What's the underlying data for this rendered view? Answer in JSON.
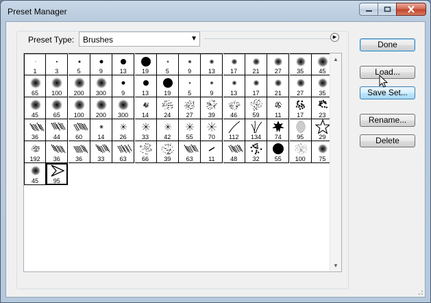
{
  "window": {
    "title": "Preset Manager"
  },
  "preset_type": {
    "label": "Preset Type:",
    "value": "Brushes"
  },
  "buttons": {
    "done": "Done",
    "load": "Load...",
    "save_set": "Save Set...",
    "rename": "Rename...",
    "delete": "Delete"
  },
  "brushes": [
    {
      "n": "1",
      "k": "hard",
      "r": 0.5
    },
    {
      "n": "3",
      "k": "hard",
      "r": 1
    },
    {
      "n": "5",
      "k": "hard",
      "r": 1.5
    },
    {
      "n": "9",
      "k": "hard",
      "r": 2.5
    },
    {
      "n": "13",
      "k": "hard",
      "r": 4
    },
    {
      "n": "19",
      "k": "hard",
      "r": 7
    },
    {
      "n": "5",
      "k": "soft",
      "r": 2
    },
    {
      "n": "9",
      "k": "soft",
      "r": 3
    },
    {
      "n": "13",
      "k": "soft",
      "r": 4
    },
    {
      "n": "17",
      "k": "soft",
      "r": 5
    },
    {
      "n": "21",
      "k": "soft",
      "r": 6
    },
    {
      "n": "27",
      "k": "soft",
      "r": 7
    },
    {
      "n": "35",
      "k": "soft",
      "r": 8
    },
    {
      "n": "45",
      "k": "soft",
      "r": 9
    },
    {
      "n": "65",
      "k": "soft",
      "r": 9
    },
    {
      "n": "100",
      "k": "soft",
      "r": 9
    },
    {
      "n": "200",
      "k": "soft",
      "r": 9
    },
    {
      "n": "300",
      "k": "soft",
      "r": 9
    },
    {
      "n": "9",
      "k": "hard",
      "r": 2.5
    },
    {
      "n": "13",
      "k": "hard",
      "r": 4
    },
    {
      "n": "19",
      "k": "hard",
      "r": 7
    },
    {
      "n": "5",
      "k": "soft",
      "r": 2
    },
    {
      "n": "9",
      "k": "soft",
      "r": 3
    },
    {
      "n": "13",
      "k": "soft",
      "r": 4
    },
    {
      "n": "17",
      "k": "soft",
      "r": 5
    },
    {
      "n": "21",
      "k": "soft",
      "r": 6
    },
    {
      "n": "27",
      "k": "soft",
      "r": 7
    },
    {
      "n": "35",
      "k": "soft",
      "r": 8
    },
    {
      "n": "45",
      "k": "soft",
      "r": 9
    },
    {
      "n": "65",
      "k": "soft",
      "r": 9
    },
    {
      "n": "100",
      "k": "soft",
      "r": 9
    },
    {
      "n": "200",
      "k": "soft",
      "r": 9
    },
    {
      "n": "300",
      "k": "soft",
      "r": 9
    },
    {
      "n": "14",
      "k": "spray",
      "r": 4
    },
    {
      "n": "24",
      "k": "spray",
      "r": 8
    },
    {
      "n": "27",
      "k": "spray",
      "r": 8
    },
    {
      "n": "39",
      "k": "spray",
      "r": 8
    },
    {
      "n": "46",
      "k": "spray",
      "r": 8
    },
    {
      "n": "59",
      "k": "spray",
      "r": 9
    },
    {
      "n": "11",
      "k": "spray",
      "r": 5
    },
    {
      "n": "17",
      "k": "scatter",
      "r": 7
    },
    {
      "n": "23",
      "k": "scatter",
      "r": 8
    },
    {
      "n": "36",
      "k": "chalk",
      "r": 9
    },
    {
      "n": "44",
      "k": "chalk",
      "r": 9
    },
    {
      "n": "60",
      "k": "chalk",
      "r": 9
    },
    {
      "n": "14",
      "k": "star",
      "r": 3
    },
    {
      "n": "26",
      "k": "star",
      "r": 5
    },
    {
      "n": "33",
      "k": "star",
      "r": 6
    },
    {
      "n": "42",
      "k": "star",
      "r": 5
    },
    {
      "n": "55",
      "k": "star",
      "r": 6
    },
    {
      "n": "70",
      "k": "star",
      "r": 7
    },
    {
      "n": "112",
      "k": "grass1",
      "r": 9
    },
    {
      "n": "134",
      "k": "grass2",
      "r": 9
    },
    {
      "n": "74",
      "k": "leaf",
      "r": 9
    },
    {
      "n": "95",
      "k": "leaf2",
      "r": 9
    },
    {
      "n": "29",
      "k": "staricon",
      "r": 9
    },
    {
      "n": "192",
      "k": "spray",
      "r": 6
    },
    {
      "n": "36",
      "k": "chalk",
      "r": 9
    },
    {
      "n": "36",
      "k": "chalk",
      "r": 9
    },
    {
      "n": "33",
      "k": "chalk",
      "r": 9
    },
    {
      "n": "63",
      "k": "chalk",
      "r": 9
    },
    {
      "n": "66",
      "k": "spray",
      "r": 9
    },
    {
      "n": "39",
      "k": "spray",
      "r": 9
    },
    {
      "n": "63",
      "k": "chalk",
      "r": 9
    },
    {
      "n": "11",
      "k": "line",
      "r": 4
    },
    {
      "n": "48",
      "k": "chalk",
      "r": 8
    },
    {
      "n": "32",
      "k": "scatter",
      "r": 8
    },
    {
      "n": "55",
      "k": "hard",
      "r": 8
    },
    {
      "n": "100",
      "k": "speckle",
      "r": 9
    },
    {
      "n": "75",
      "k": "soft",
      "r": 8
    },
    {
      "n": "45",
      "k": "soft",
      "r": 8
    },
    {
      "n": "95",
      "k": "arrow",
      "r": 9
    }
  ],
  "brushes_layout_note_removed": true
}
